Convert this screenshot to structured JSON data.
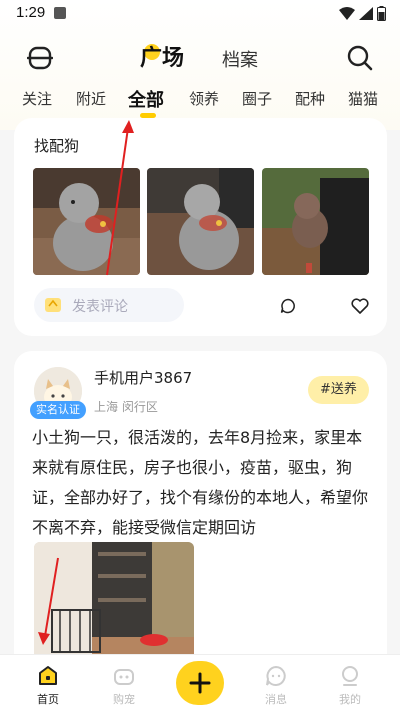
{
  "status_bar": {
    "time": "1:29"
  },
  "header": {
    "tab_active": "广场",
    "tab_other": "档案",
    "menu_icon": "menu-icon",
    "search_icon": "search-icon"
  },
  "categories": [
    "关注",
    "附近",
    "全部",
    "领养",
    "圈子",
    "配种",
    "猫猫"
  ],
  "active_category": "全部",
  "post1": {
    "title": "找配狗",
    "comment_placeholder": "发表评论"
  },
  "post2": {
    "username": "手机用户3867",
    "verify_badge": "实名认证",
    "location": "上海 闵行区",
    "tag": "#送养",
    "body": "小土狗一只，很活泼的，去年8月捡来，家里本来就有原住民，房子也很小，疫苗，驱虫，狗证，全部办好了，找个有缘份的本地人，希望你不离不弃，能接受微信定期回访"
  },
  "bottom_nav": {
    "home": "首页",
    "buy": "购宠",
    "messages": "消息",
    "mine": "我的"
  },
  "colors": {
    "accent": "#ffd21e",
    "badge_blue": "#43a0ff",
    "tag_bg": "#ffefa8",
    "annotation": "#e02020"
  }
}
